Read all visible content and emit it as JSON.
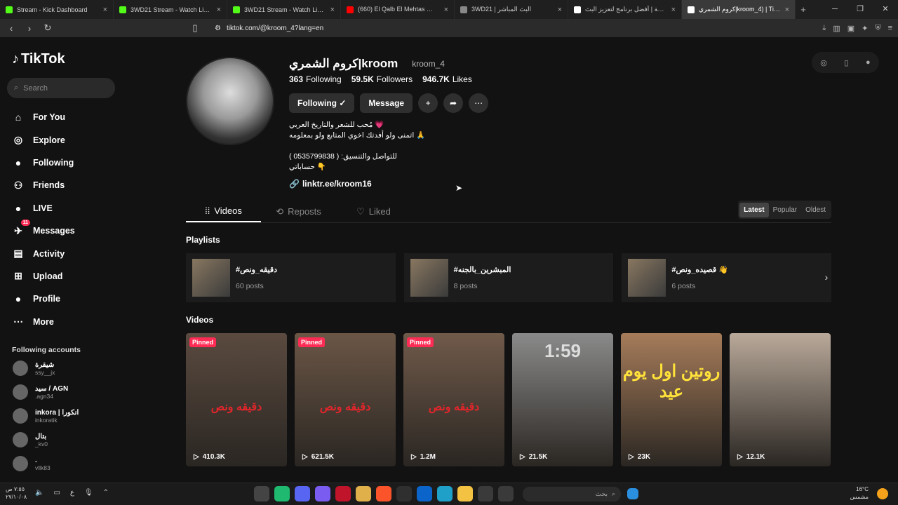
{
  "browser": {
    "tabs": [
      {
        "title": "Stream - Kick Dashboard",
        "color": "#53fc18"
      },
      {
        "title": "3WD21 Stream - Watch Live on Kick",
        "color": "#53fc18"
      },
      {
        "title": "3WD21 Stream - Watch Live on Kick",
        "color": "#53fc18"
      },
      {
        "title": "(660) El Qalb El Mehtas قلب المحتاس",
        "color": "#ff0000"
      },
      {
        "title": "3WD21 | البث المباشر",
        "color": "#888888"
      },
      {
        "title": "بوت الدردشة | أفضل برنامج لتعزيز البث",
        "color": "#ffffff"
      },
      {
        "title": "كروم الشمري|kroom_4) | TikTok",
        "color": "#ffffff",
        "active": true
      }
    ],
    "url": "tiktok.com/@kroom_4?lang=en"
  },
  "sidebar": {
    "logo": "TikTok",
    "search_placeholder": "Search",
    "menu": [
      {
        "label": "For You",
        "icon": "home-icon"
      },
      {
        "label": "Explore",
        "icon": "compass-icon"
      },
      {
        "label": "Following",
        "icon": "following-avatar-icon"
      },
      {
        "label": "Friends",
        "icon": "friends-icon"
      },
      {
        "label": "LIVE",
        "icon": "live-icon"
      },
      {
        "label": "Messages",
        "icon": "messages-icon",
        "badge": "11"
      },
      {
        "label": "Activity",
        "icon": "activity-icon"
      },
      {
        "label": "Upload",
        "icon": "upload-icon"
      },
      {
        "label": "Profile",
        "icon": "profile-icon"
      },
      {
        "label": "More",
        "icon": "more-icon"
      }
    ],
    "following_header": "Following accounts",
    "following": [
      {
        "name": "شيقرة",
        "handle": "ssy__jx"
      },
      {
        "name": "سيد / AGN",
        "handle": ".agn34"
      },
      {
        "name": "inkora | انكورا",
        "handle": "inkoratik"
      },
      {
        "name": "بتال",
        "handle": "_kv0"
      },
      {
        "name": ".",
        "handle": "vllk83"
      }
    ]
  },
  "profile": {
    "display_name": "كروم الشمري|kroom",
    "username": "kroom_4",
    "following_count": "363",
    "following_label": "Following",
    "followers_count": "59.5K",
    "followers_label": "Followers",
    "likes_count": "946.7K",
    "likes_label": "Likes",
    "following_btn": "Following ✓",
    "message_btn": "Message",
    "bio": [
      "مُحب للشعر والتاريخ العربي 💗",
      "اتمنى ولو أفدتك اخوي المتابع ولو بمعلومه 🙏",
      "",
      "للتواصل والتنسيق: ( 0535799838 )",
      "حساباتي 👇"
    ],
    "link": "linktr.ee/kroom16"
  },
  "tabs": [
    "Videos",
    "Reposts",
    "Liked"
  ],
  "sort": [
    "Latest",
    "Popular",
    "Oldest"
  ],
  "playlists_header": "Playlists",
  "playlists": [
    {
      "name": "#دقيقه_ونص",
      "count": "60 posts"
    },
    {
      "name": "#المبشرين_بالجنه",
      "count": "8 posts"
    },
    {
      "name": "#قصيده_ونص 👋",
      "count": "6 posts"
    }
  ],
  "videos_header": "Videos",
  "videos": [
    {
      "pinned": "Pinned",
      "views": "410.3K",
      "overlay": "دقيقه ونص",
      "bg": "#5a4a3f"
    },
    {
      "pinned": "Pinned",
      "views": "621.5K",
      "overlay": "دقيقه ونص",
      "bg": "#6b5646"
    },
    {
      "pinned": "Pinned",
      "views": "1.2M",
      "overlay": "دقيقه ونص",
      "bg": "#705a4a"
    },
    {
      "pinned": "",
      "views": "21.5K",
      "overlay": "1:59",
      "bg": "#8a8a8a"
    },
    {
      "pinned": "",
      "views": "23K",
      "overlay": "روتين اول يوم عيد",
      "bg": "#a67c5a"
    },
    {
      "pinned": "",
      "views": "12.1K",
      "overlay": "",
      "bg": "#b9a99a"
    }
  ],
  "taskbar": {
    "time": "٧:٥٥ ص",
    "date": "٢٧/١٠/٠٨",
    "search": "بحث",
    "weather_temp": "16°C",
    "weather_text": "مشمس"
  }
}
